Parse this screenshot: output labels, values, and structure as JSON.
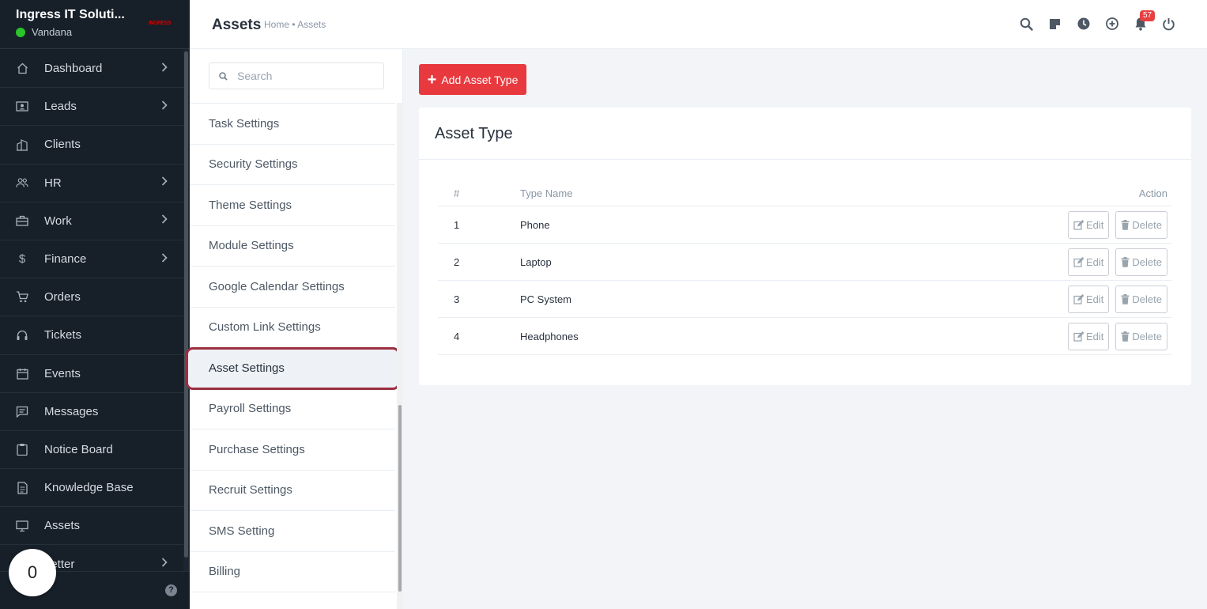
{
  "sidebar": {
    "company": "Ingress IT Soluti...",
    "user": "Vandana",
    "logo_text": "INGRESS",
    "items": [
      {
        "label": "Dashboard",
        "icon": "home-icon",
        "chevron": true
      },
      {
        "label": "Leads",
        "icon": "id-card-icon",
        "chevron": true
      },
      {
        "label": "Clients",
        "icon": "building-icon",
        "chevron": false
      },
      {
        "label": "HR",
        "icon": "people-icon",
        "chevron": true
      },
      {
        "label": "Work",
        "icon": "briefcase-icon",
        "chevron": true
      },
      {
        "label": "Finance",
        "icon": "dollar-icon",
        "chevron": true
      },
      {
        "label": "Orders",
        "icon": "cart-icon",
        "chevron": false
      },
      {
        "label": "Tickets",
        "icon": "headset-icon",
        "chevron": false
      },
      {
        "label": "Events",
        "icon": "calendar-icon",
        "chevron": false
      },
      {
        "label": "Messages",
        "icon": "message-icon",
        "chevron": false
      },
      {
        "label": "Notice Board",
        "icon": "clipboard-icon",
        "chevron": false
      },
      {
        "label": "Knowledge Base",
        "icon": "document-icon",
        "chevron": false
      },
      {
        "label": "Assets",
        "icon": "monitor-icon",
        "chevron": false
      },
      {
        "label": "Letter",
        "icon": "letter-icon",
        "chevron": true
      }
    ],
    "counter": "0"
  },
  "header": {
    "title": "Assets",
    "breadcrumb": "Home • Assets",
    "notification_count": "57",
    "icons": [
      "search-icon",
      "sticky-note-icon",
      "clock-icon",
      "add-circle-icon",
      "notification-bell-icon",
      "power-icon"
    ]
  },
  "settings": {
    "search_placeholder": "Search",
    "items": [
      "Task Settings",
      "Security Settings",
      "Theme Settings",
      "Module Settings",
      "Google Calendar Settings",
      "Custom Link Settings",
      "Asset Settings",
      "Payroll Settings",
      "Purchase Settings",
      "Recruit Settings",
      "SMS Setting",
      "Billing"
    ],
    "active": "Asset Settings"
  },
  "main": {
    "add_button": "Add Asset Type",
    "card_title": "Asset Type",
    "columns": [
      "#",
      "Type Name",
      "Action"
    ],
    "edit_label": "Edit",
    "delete_label": "Delete",
    "rows": [
      {
        "num": "1",
        "name": "Phone"
      },
      {
        "num": "2",
        "name": "Laptop"
      },
      {
        "num": "3",
        "name": "PC System"
      },
      {
        "num": "4",
        "name": "Headphones"
      }
    ]
  },
  "colors": {
    "sidebar_bg": "#171f29",
    "accent_red": "#e8393f",
    "highlight_outline": "#9b2f3f",
    "online_green": "#2bc42b"
  }
}
